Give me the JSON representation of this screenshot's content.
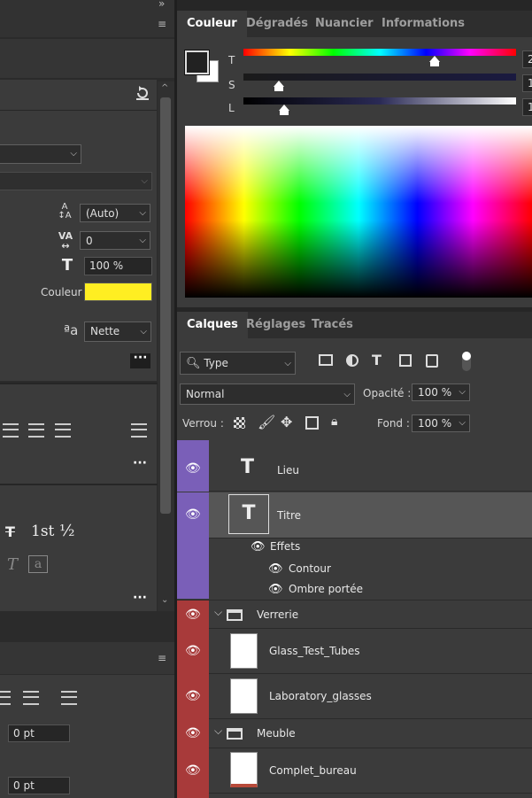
{
  "left_panel": {
    "dropdown_values": {
      "leading": "(Auto)",
      "tracking": "0",
      "antialias": "Nette"
    },
    "fields": {
      "horizontal_scale": "100 %",
      "indent_1": "0 pt",
      "indent_2": "0 pt"
    },
    "labels": {
      "color": "Couleur",
      "ordinal": "1st",
      "fraction": "½",
      "antialias_icon": "ªa"
    },
    "colors": {
      "text_color_swatch": "#ffee22"
    }
  },
  "color_panel": {
    "tabs": [
      "Couleur",
      "Dégradés",
      "Nuancier",
      "Informations"
    ],
    "active_tab": 0,
    "sliders": [
      {
        "label": "T",
        "value_fraction": 0.7,
        "readout": "2"
      },
      {
        "label": "S",
        "value_fraction": 0.13,
        "readout": "1"
      },
      {
        "label": "L",
        "value_fraction": 0.15,
        "readout": "1"
      }
    ],
    "colors": {
      "foreground": "#222222",
      "background": "#ffffff"
    }
  },
  "layers_panel": {
    "tabs": [
      "Calques",
      "Réglages",
      "Tracés"
    ],
    "active_tab": 0,
    "filter": {
      "value": "Type"
    },
    "blend_mode": "Normal",
    "opacity_label": "Opacité :",
    "opacity_value": "100 %",
    "lock_label": "Verrou :",
    "fill_label": "Fond :",
    "fill_value": "100 %",
    "layers": [
      {
        "name": "Lieu",
        "kind": "text",
        "selected": false
      },
      {
        "name": "Titre",
        "kind": "text",
        "selected": true
      },
      {
        "name": "Effets",
        "kind": "effects-header"
      },
      {
        "name": "Contour",
        "kind": "effect"
      },
      {
        "name": "Ombre portée",
        "kind": "effect"
      },
      {
        "name": "Verrerie",
        "kind": "group"
      },
      {
        "name": "Glass_Test_Tubes",
        "kind": "image"
      },
      {
        "name": "Laboratory_glasses",
        "kind": "image"
      },
      {
        "name": "Meuble",
        "kind": "group"
      },
      {
        "name": "Complet_bureau",
        "kind": "image"
      }
    ],
    "colors": {
      "purple_label": "#7a5fb8",
      "red_label": "#a83a3a"
    }
  }
}
